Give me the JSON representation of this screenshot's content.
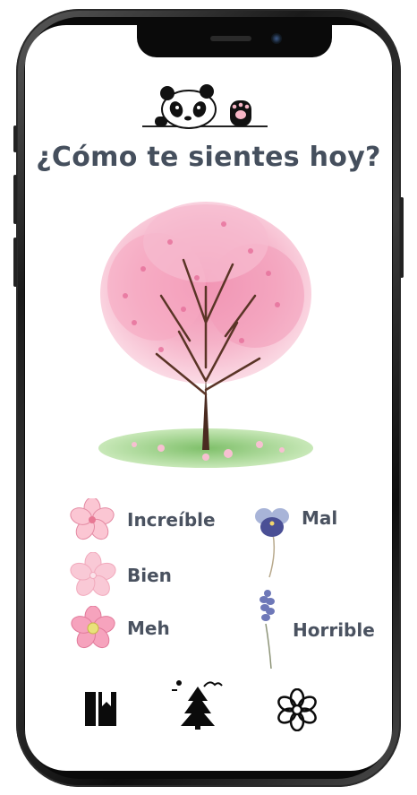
{
  "app": {
    "title": "¿Cómo te sientes hoy?"
  },
  "moods": [
    {
      "label": "Increíble",
      "icon": "cherry-blossom-light-icon"
    },
    {
      "label": "Bien",
      "icon": "cherry-blossom-pale-icon"
    },
    {
      "label": "Meh",
      "icon": "cherry-blossom-yellow-center-icon"
    },
    {
      "label": "Mal",
      "icon": "pansy-flower-icon"
    },
    {
      "label": "Horrible",
      "icon": "lavender-sprig-icon"
    }
  ],
  "bottom_nav": [
    {
      "icon": "journal-book-icon"
    },
    {
      "icon": "tree-landscape-icon"
    },
    {
      "icon": "flower-outline-icon"
    }
  ],
  "colors": {
    "title": "#454f5d",
    "blossom": "#f4a7bf",
    "grass": "#9fd08a"
  }
}
